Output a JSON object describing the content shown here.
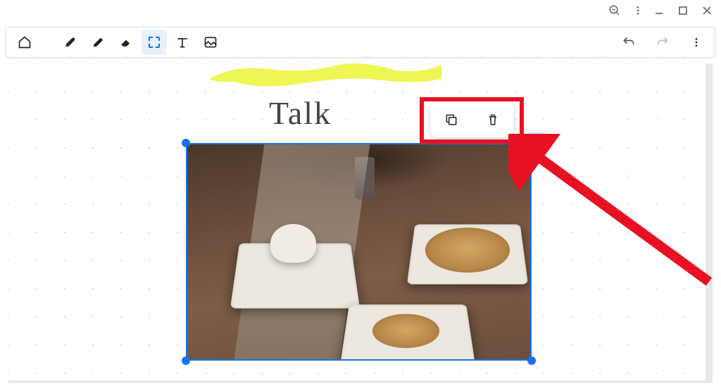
{
  "window": {
    "zoom_out": "zoom-out",
    "menu": "kebab-menu",
    "minimize": "minimize",
    "maximize": "maximize",
    "close": "close"
  },
  "toolbar": {
    "home": "home",
    "pen": "pen",
    "highlighter": "highlighter",
    "eraser": "eraser",
    "select": "select",
    "text": "text",
    "image": "image",
    "undo": "undo",
    "redo": "redo",
    "more": "more"
  },
  "canvas": {
    "handwritten_text": "Talk",
    "highlighter_color": "#ecf542"
  },
  "selection": {
    "border_color": "#1a73e8",
    "actions": {
      "copy": "copy",
      "delete": "delete"
    },
    "more_pill": "more-options"
  },
  "annotation": {
    "highlight_color": "#e81123",
    "arrow_color": "#e81123"
  }
}
